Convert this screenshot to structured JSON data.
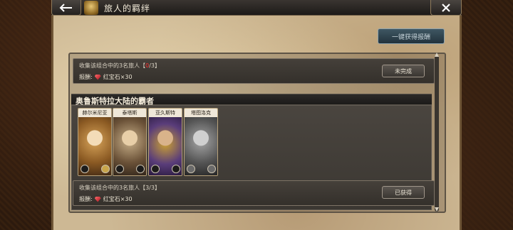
{
  "header": {
    "title": "旅人的羁绊"
  },
  "toolbar": {
    "claim_all_label": "一键获得报酬"
  },
  "combos": [
    {
      "requirement_prefix": "收集该组合中的3名旅人【",
      "progress_current": "0",
      "progress_suffix": "/3】",
      "reward_label": "报酬:",
      "reward_item": "红宝石×30",
      "status_label": "未完成"
    },
    {
      "group_title": "奥鲁斯特拉大陆的霸者",
      "requirement_text": "收集该组合中的3名旅人【3/3】",
      "reward_label": "报酬:",
      "reward_item": "红宝石×30",
      "status_label": "已获得",
      "characters": [
        {
          "name": "赫尔米尼亚"
        },
        {
          "name": "泰塔斯"
        },
        {
          "name": "亚久斯特"
        },
        {
          "name": "塔图洛克"
        }
      ]
    }
  ],
  "colors": {
    "incomplete_progress": "#ff3030",
    "ruby": "#c4141e"
  }
}
